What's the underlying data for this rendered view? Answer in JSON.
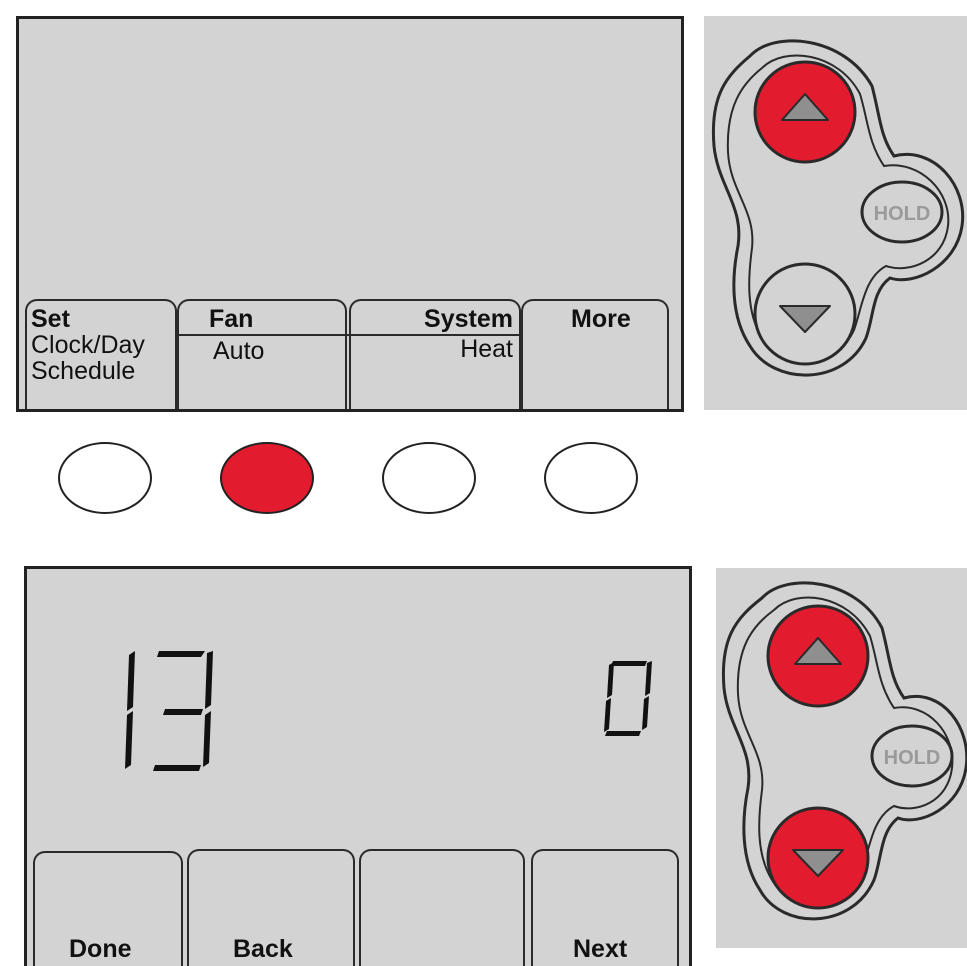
{
  "top_screen": {
    "tabs": [
      {
        "title": "Set",
        "lines": [
          "Clock/Day",
          "Schedule"
        ]
      },
      {
        "title": "Fan",
        "lines": [
          "Auto"
        ]
      },
      {
        "title": "System",
        "lines": [
          "Heat"
        ]
      },
      {
        "title": "More",
        "lines": []
      }
    ]
  },
  "top_panel": {
    "hold_label": "HOLD",
    "up_active": true,
    "down_active": false
  },
  "soft_buttons": [
    {
      "active": false
    },
    {
      "active": true
    },
    {
      "active": false
    },
    {
      "active": false
    }
  ],
  "bottom_screen": {
    "left_value": "13",
    "right_value": "0",
    "tabs": [
      "Done",
      "Back",
      "",
      "Next"
    ]
  },
  "bottom_panel": {
    "hold_label": "HOLD",
    "up_active": true,
    "down_active": true
  },
  "colors": {
    "accent_red": "#e31b2e",
    "lcd_gray": "#d3d3d3",
    "outline": "#222222"
  }
}
